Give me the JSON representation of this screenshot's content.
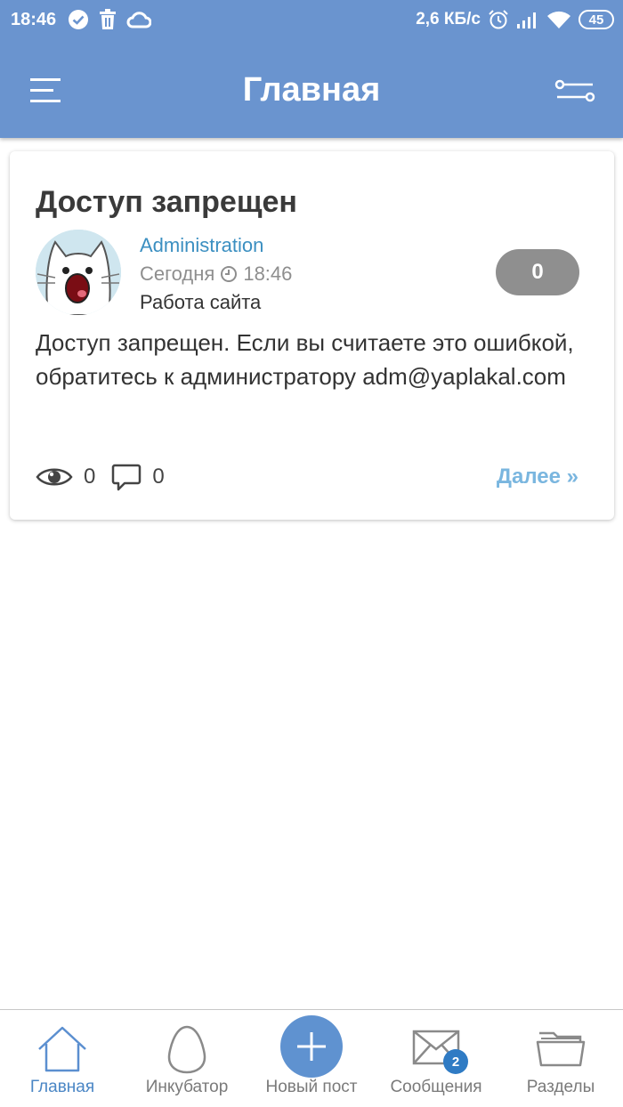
{
  "status_bar": {
    "time": "18:46",
    "net_speed": "2,6 КБ/с",
    "battery": "45",
    "left_icons": [
      "check-circle-icon",
      "trash-icon",
      "cloud-icon"
    ],
    "right_icons": [
      "alarm-icon",
      "signal-icon",
      "wifi-icon"
    ]
  },
  "app_bar": {
    "title": "Главная",
    "menu_icon": "hamburger-menu-icon",
    "filter_icon": "filter-sliders-icon"
  },
  "post": {
    "title": "Доступ запрещен",
    "author": "Administration",
    "date_label": "Сегодня",
    "time": "18:46",
    "category": "Работа сайта",
    "rating": "0",
    "body": "Доступ запрещен. Если вы считаете это ошибкой, обратитесь к администратору adm@yaplakal.com",
    "views": "0",
    "comments": "0",
    "more_link": "Далее »"
  },
  "bottom_nav": {
    "items": [
      {
        "label": "Главная",
        "icon": "home-icon",
        "active": true
      },
      {
        "label": "Инкубатор",
        "icon": "egg-icon",
        "active": false
      },
      {
        "label": "Новый пост",
        "icon": "plus-icon",
        "active": false
      },
      {
        "label": "Сообщения",
        "icon": "envelope-icon",
        "active": false,
        "badge": "2"
      },
      {
        "label": "Разделы",
        "icon": "folder-icon",
        "active": false
      }
    ]
  },
  "colors": {
    "header": "#6a94cf",
    "link": "#3b8fc1",
    "more_link": "#7ab6df",
    "active_nav": "#4a86c5",
    "fab": "#5f92d0",
    "rating_bg": "#8f8f8f"
  }
}
